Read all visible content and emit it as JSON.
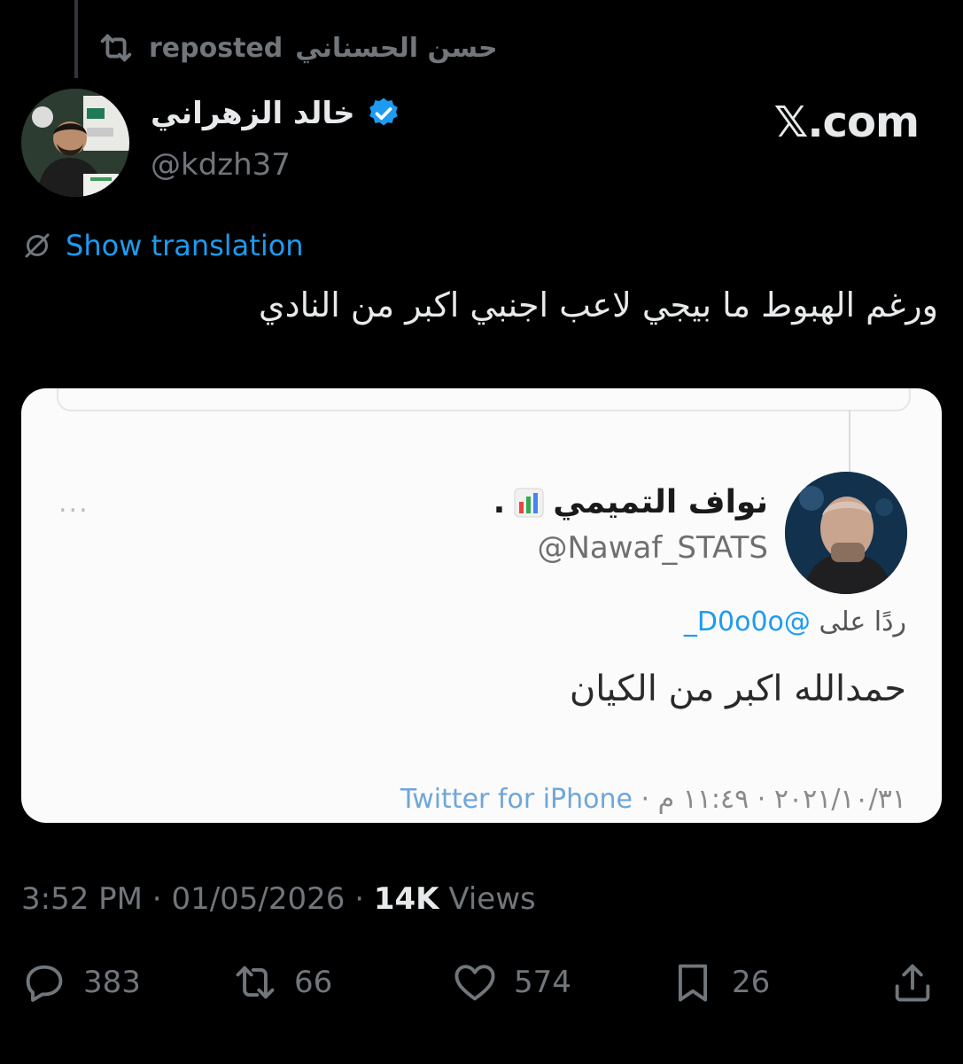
{
  "repost": {
    "reposter": "حسن الحسناني",
    "label": "reposted"
  },
  "author": {
    "name": "خالد الزهراني",
    "handle": "@kdzh37",
    "verified": true
  },
  "brand": "𝕏.com",
  "translation": {
    "label": "Show translation"
  },
  "tweet": {
    "text": "ورغم الهبوط ما بيجي لاعب اجنبي اكبر من النادي"
  },
  "embedded": {
    "name": "نواف التميمي",
    "suffix": ".",
    "handle": "@Nawaf_STATS",
    "more": "...",
    "reply_prefix": "ردًا على",
    "reply_mention": "@D0o0o_",
    "body": "حمدالله اكبر من الكيان",
    "date": "٢٠٢١/١٠/٣١",
    "time": "١١:٤٩ م",
    "source": "Twitter for iPhone"
  },
  "meta": {
    "time": "3:52 PM",
    "date": "01/05/2026",
    "views_count": "14K",
    "views_label": "Views"
  },
  "actions": {
    "replies": "383",
    "reposts": "66",
    "likes": "574",
    "bookmarks": "26"
  },
  "colors": {
    "accent": "#1d9bf0",
    "muted": "#71767b",
    "text": "#e7e9ea",
    "background": "#000000"
  },
  "icons": [
    "repost-icon",
    "verified-icon",
    "translate-icon",
    "reply-icon",
    "like-icon",
    "bookmark-icon",
    "share-icon",
    "chart-emoji-icon"
  ]
}
